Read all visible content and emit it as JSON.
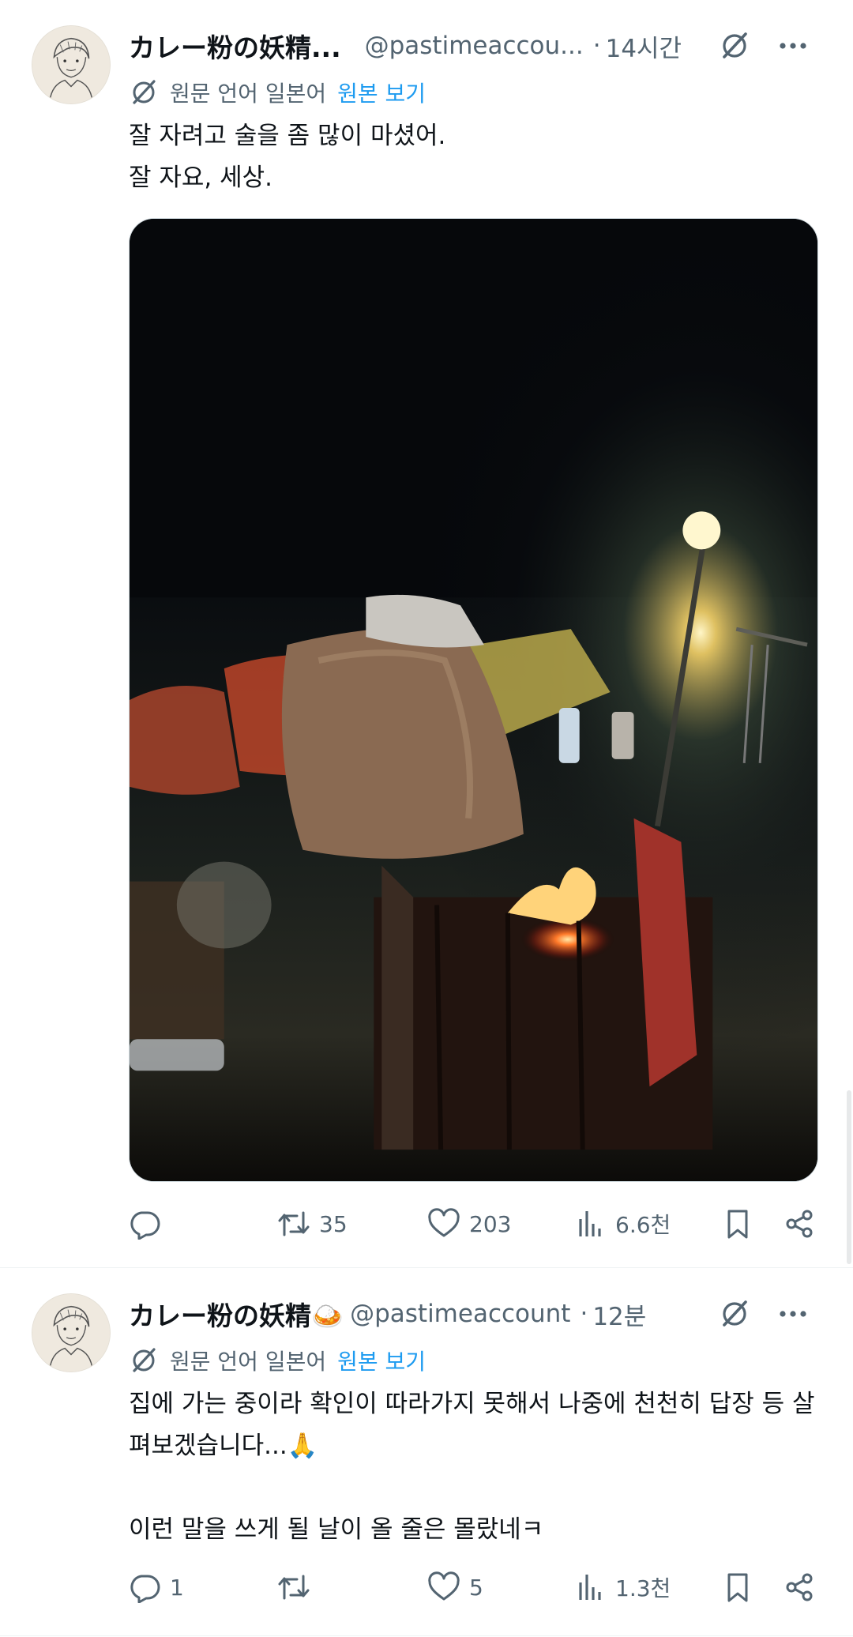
{
  "tweets": [
    {
      "display_name": "カレー粉の妖精...",
      "handle": "@pastimeaccou...",
      "separator": "·",
      "time": "14시간",
      "translation_note": "원문 언어 일본어",
      "show_original": "원본 보기",
      "text": "잘 자려고 술을 좀 많이 마셨어.\n잘 자요, 세상.",
      "media_icon": "campfire-photo",
      "actions": {
        "reply_count": "",
        "retweet_count": "35",
        "like_count": "203",
        "view_count": "6.6천"
      }
    },
    {
      "display_name": "カレー粉の妖精🍛",
      "handle": "@pastimeaccount",
      "separator": "·",
      "time": "12분",
      "translation_note": "원문 언어 일본어",
      "show_original": "원본 보기",
      "text": "집에 가는 중이라 확인이 따라가지 못해서 나중에 천천히 답장 등 살펴보겠습니다...🙏\n\n이런 말을 쓰게 될 날이 올 줄은 몰랐네ㅋ",
      "actions": {
        "reply_count": "1",
        "retweet_count": "",
        "like_count": "5",
        "view_count": "1.3천"
      }
    }
  ],
  "colors": {
    "text_primary": "#0f1419",
    "text_secondary": "#536471",
    "link_blue": "#1d9bf0",
    "divider": "#eff3f4"
  },
  "icons": [
    "grok-icon",
    "more-icon",
    "translate-icon",
    "reply-icon",
    "retweet-icon",
    "like-icon",
    "views-icon",
    "bookmark-icon",
    "share-icon"
  ]
}
